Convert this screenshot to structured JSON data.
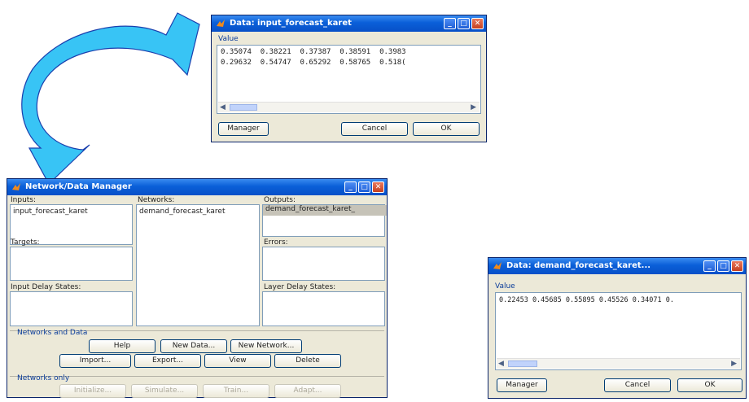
{
  "data_dialog_top": {
    "title": "Data: input_forecast_karet",
    "value_label": "Value",
    "value_lines": [
      "0.35074  0.38221  0.37387  0.38591  0.3983",
      "0.29632  0.54747  0.65292  0.58765  0.518("
    ],
    "buttons": {
      "manager": "Manager",
      "cancel": "Cancel",
      "ok": "OK"
    }
  },
  "data_dialog_right": {
    "title": "Data: demand_forecast_karet...",
    "value_label": "Value",
    "value_lines": [
      "0.22453 0.45685 0.55895 0.45526 0.34071 0."
    ],
    "buttons": {
      "manager": "Manager",
      "cancel": "Cancel",
      "ok": "OK"
    }
  },
  "manager": {
    "title": "Network/Data Manager",
    "inputs_label": "Inputs:",
    "inputs_items": [
      "input_forecast_karet"
    ],
    "networks_label": "Networks:",
    "networks_items": [
      "demand_forecast_karet"
    ],
    "outputs_label": "Outputs:",
    "outputs_items": [
      "demand_forecast_karet_"
    ],
    "targets_label": "Targets:",
    "errors_label": "Errors:",
    "input_delay_label": "Input Delay States:",
    "layer_delay_label": "Layer Delay States:",
    "group1_label": "Networks and Data",
    "btn_help": "Help",
    "btn_new_data": "New Data...",
    "btn_new_network": "New Network...",
    "btn_import": "Import...",
    "btn_export": "Export...",
    "btn_view": "View",
    "btn_delete": "Delete",
    "group2_label": "Networks only",
    "btn_initialize": "Initialize...",
    "btn_simulate": "Simulate...",
    "btn_train": "Train...",
    "btn_adapt": "Adapt..."
  },
  "colors": {
    "titlebar": "#0a5fd8",
    "arrow_fill": "#38c4f5",
    "arrow_stroke": "#1a3fae",
    "window_bg": "#ece9d8"
  }
}
